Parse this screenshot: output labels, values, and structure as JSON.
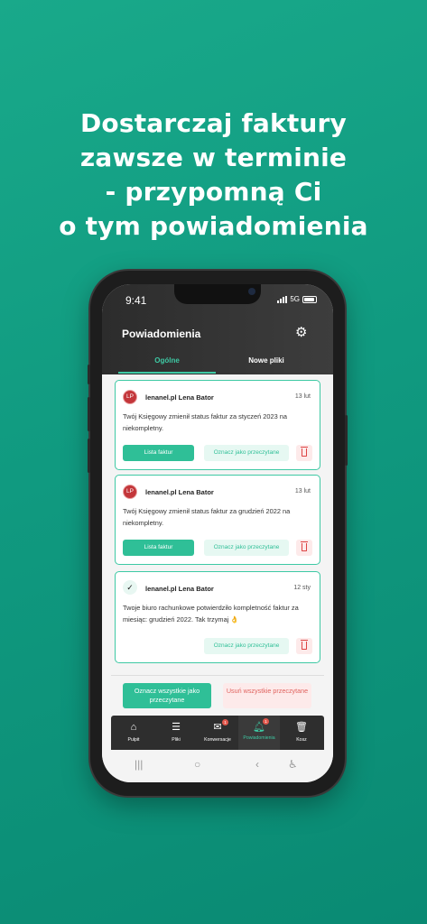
{
  "headline": [
    "Dostarczaj faktury",
    "zawsze w terminie",
    "- przypomną Ci",
    "o tym powiadomienia"
  ],
  "status_bar": {
    "time": "9:41",
    "network": "5G"
  },
  "header": {
    "title": "Powiadomienia",
    "settings_icon": "gear-icon"
  },
  "tabs": [
    {
      "label": "Ogólne",
      "active": true
    },
    {
      "label": "Nowe pliki",
      "active": false
    }
  ],
  "notifications": [
    {
      "avatar": "LP",
      "sender": "lenanel.pl Lena Bator",
      "date": "13 lut",
      "message": "Twój Księgowy zmienił status faktur za styczeń 2023 na niekompletny.",
      "primary_action": "Lista faktur",
      "mark_read": "Oznacz jako przeczytane",
      "read": false
    },
    {
      "avatar": "LP",
      "sender": "lenanel.pl Lena Bator",
      "date": "13 lut",
      "message": "Twój Księgowy zmienił status faktur za grudzień 2022 na niekompletny.",
      "primary_action": "Lista faktur",
      "mark_read": "Oznacz jako przeczytane",
      "read": false
    },
    {
      "avatar": "✓",
      "sender": "lenanel.pl Lena Bator",
      "date": "12 sty",
      "message": "Twoje biuro rachunkowe potwierdziło kompletność faktur za miesiąc: grudzień 2022. Tak trzymaj 👌",
      "mark_read": "Oznacz jako przeczytane",
      "read": true
    }
  ],
  "bulk_actions": {
    "mark_all_read": "Oznacz wszystkie jako przeczytane",
    "delete_all_read": "Usuń wszystkie przeczytane"
  },
  "bottom_nav": [
    {
      "label": "Pulpit",
      "icon": "home-icon"
    },
    {
      "label": "Pliki",
      "icon": "list-icon"
    },
    {
      "label": "Konwersacje",
      "icon": "mail-icon",
      "badge": "1"
    },
    {
      "label": "Powiadomienia",
      "icon": "bell-icon",
      "badge": "1",
      "active": true
    },
    {
      "label": "Kosz",
      "icon": "trash-icon"
    }
  ],
  "colors": {
    "accent": "#2fbf97",
    "danger": "#e0635f",
    "header_bg": "#333333",
    "page_bg": "#12a084"
  }
}
